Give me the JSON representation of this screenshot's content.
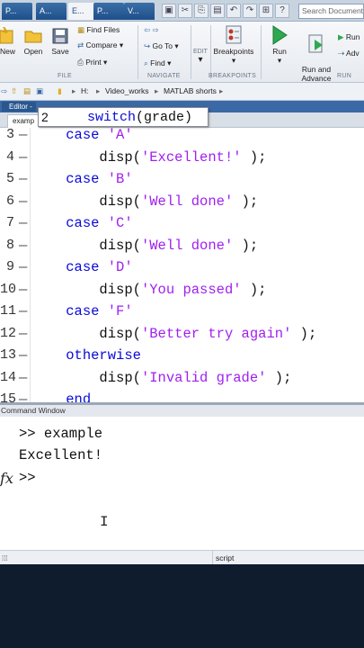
{
  "window": {
    "tabs": [
      "P...",
      "A...",
      "E...",
      "P...",
      "V..."
    ],
    "active_tab_index": 2,
    "search_placeholder": "Search Documentation"
  },
  "ribbon": {
    "new_label": "New",
    "open_label": "Open",
    "save_label": "Save",
    "find_files_label": "Find Files",
    "compare_label": "Compare",
    "print_label": "Print",
    "goto_label": "Go To",
    "find_label": "Find",
    "edit_label": "EDIT",
    "breakpoints_label": "Breakpoints",
    "run_label": "Run",
    "run_and_advance_label": "Run and\nAdvance",
    "run_section_btn": "Run",
    "adv_label": "Adv",
    "section_file": "FILE",
    "section_navigate": "NAVIGATE",
    "section_breakpoints": "BREAKPOINTS",
    "section_run": "RUN"
  },
  "address": {
    "drive": "H:",
    "folder1": "Video_works",
    "folder2": "MATLAB shorts"
  },
  "editor": {
    "panel_title": "Editor -",
    "file_tab": "examp",
    "tooltip_line": "2",
    "tooltip_code": "switch(grade)",
    "lines": [
      {
        "n": "3",
        "indent": "    ",
        "parts": [
          {
            "t": "case ",
            "c": "kw"
          },
          {
            "t": "'A'",
            "c": "st"
          }
        ]
      },
      {
        "n": "4",
        "indent": "        ",
        "parts": [
          {
            "t": "disp(",
            "c": "tx"
          },
          {
            "t": "'Excellent!'",
            "c": "st"
          },
          {
            "t": " );",
            "c": "tx"
          }
        ]
      },
      {
        "n": "5",
        "indent": "    ",
        "parts": [
          {
            "t": "case ",
            "c": "kw"
          },
          {
            "t": "'B'",
            "c": "st"
          }
        ]
      },
      {
        "n": "6",
        "indent": "        ",
        "parts": [
          {
            "t": "disp(",
            "c": "tx"
          },
          {
            "t": "'Well done'",
            "c": "st"
          },
          {
            "t": " );",
            "c": "tx"
          }
        ]
      },
      {
        "n": "7",
        "indent": "    ",
        "parts": [
          {
            "t": "case ",
            "c": "kw"
          },
          {
            "t": "'C'",
            "c": "st"
          }
        ]
      },
      {
        "n": "8",
        "indent": "        ",
        "parts": [
          {
            "t": "disp(",
            "c": "tx"
          },
          {
            "t": "'Well done'",
            "c": "st"
          },
          {
            "t": " );",
            "c": "tx"
          }
        ]
      },
      {
        "n": "9",
        "indent": "    ",
        "parts": [
          {
            "t": "case ",
            "c": "kw"
          },
          {
            "t": "'D'",
            "c": "st"
          }
        ]
      },
      {
        "n": "10",
        "indent": "        ",
        "parts": [
          {
            "t": "disp(",
            "c": "tx"
          },
          {
            "t": "'You passed'",
            "c": "st"
          },
          {
            "t": " );",
            "c": "tx"
          }
        ]
      },
      {
        "n": "11",
        "indent": "    ",
        "parts": [
          {
            "t": "case ",
            "c": "kw"
          },
          {
            "t": "'F'",
            "c": "st"
          }
        ]
      },
      {
        "n": "12",
        "indent": "        ",
        "parts": [
          {
            "t": "disp(",
            "c": "tx"
          },
          {
            "t": "'Better try again'",
            "c": "st"
          },
          {
            "t": " );",
            "c": "tx"
          }
        ]
      },
      {
        "n": "13",
        "indent": "    ",
        "parts": [
          {
            "t": "otherwise",
            "c": "kw"
          }
        ]
      },
      {
        "n": "14",
        "indent": "        ",
        "parts": [
          {
            "t": "disp(",
            "c": "tx"
          },
          {
            "t": "'Invalid grade'",
            "c": "st"
          },
          {
            "t": " );",
            "c": "tx"
          }
        ]
      },
      {
        "n": "15",
        "indent": "    ",
        "parts": [
          {
            "t": "end",
            "c": "kw"
          }
        ]
      }
    ]
  },
  "command_window": {
    "title": "Command Window",
    "lines": [
      ">> example",
      "Excellent!",
      ">>"
    ],
    "fx_symbol": "fx"
  },
  "status": {
    "mode": "script"
  },
  "colors": {
    "keyword": "#0a0ad8",
    "string": "#a020f0",
    "editor_title_bar": "#3a69a6"
  }
}
